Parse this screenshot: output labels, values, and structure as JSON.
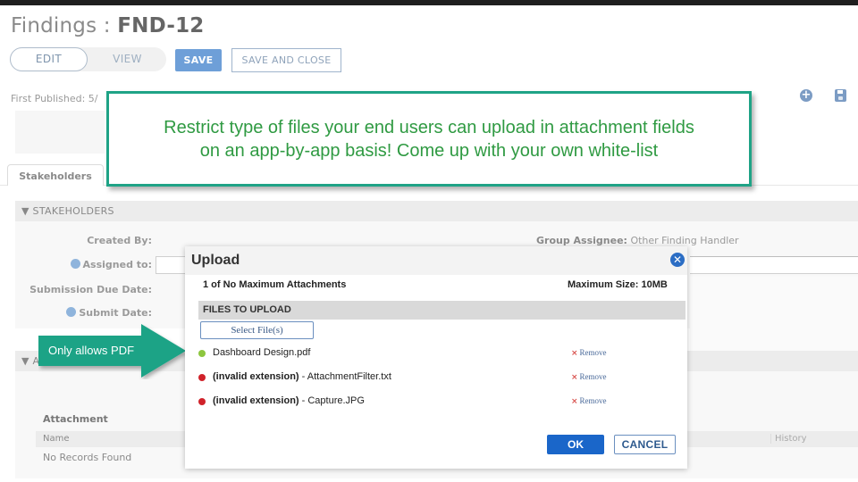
{
  "page": {
    "title_prefix": "Findings : ",
    "record_id": "FND-12",
    "first_published": "First Published: 5/"
  },
  "toolbar": {
    "edit_label": "EDIT",
    "view_label": "VIEW",
    "save_label": "SAVE",
    "save_close_label": "SAVE AND CLOSE",
    "add_icon": "plus-circle-icon",
    "save_icon": "floppy-disk-icon"
  },
  "tabs": [
    {
      "label": "Stakeholders",
      "active": true
    }
  ],
  "sections": {
    "stakeholders": {
      "header": "▼ STAKEHOLDERS",
      "fields": {
        "created_by": "Created By:",
        "assigned_to": "Assigned to:",
        "submission_due_date": "Submission Due Date:",
        "submit_date": "Submit Date:",
        "group_assignee_label": "Group Assignee:",
        "group_assignee_value": "Other Finding Handler"
      }
    },
    "attachments": {
      "header": "▼ A",
      "label": "Attachment",
      "columns": [
        "Name",
        "History"
      ],
      "empty_text": "No Records Found"
    }
  },
  "callout": {
    "line1": "Restrict type of files your end users can upload in attachment fields",
    "line2": "on an app-by-app basis! Come up with your own white-list",
    "border_color": "#1fa386",
    "text_color": "#2f9a42"
  },
  "arrow_note": {
    "text": "Only allows PDF",
    "color": "#1fa386"
  },
  "upload_dialog": {
    "title": "Upload",
    "close_icon": "close-circle-icon",
    "count_text": "1 of No Maximum Attachments",
    "max_size_text": "Maximum Size: 10MB",
    "files_header": "FILES TO UPLOAD",
    "select_button": "Select File(s)",
    "files": [
      {
        "status": "valid",
        "status_color": "#8dc63f",
        "prefix": "",
        "name": "Dashboard Design.pdf",
        "remove_label": "Remove"
      },
      {
        "status": "invalid",
        "status_color": "#d0222a",
        "prefix": "(invalid extension)",
        "name": " - AttachmentFilter.txt",
        "remove_label": "Remove"
      },
      {
        "status": "invalid",
        "status_color": "#d0222a",
        "prefix": "(invalid extension)",
        "name": " - Capture.JPG",
        "remove_label": "Remove"
      }
    ],
    "ok_label": "OK",
    "cancel_label": "CANCEL"
  }
}
